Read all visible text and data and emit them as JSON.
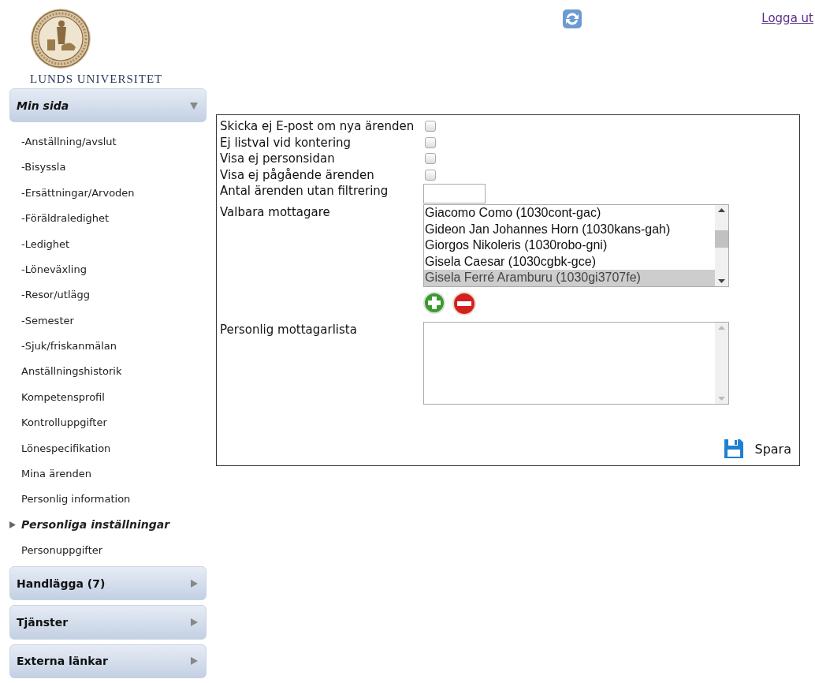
{
  "header": {
    "university": "LUNDS UNIVERSITET",
    "logout": "Logga ut"
  },
  "sidebar": [
    {
      "title": "Min sida",
      "expanded": true,
      "items": [
        {
          "label": "-Anställning/avslut",
          "selected": false
        },
        {
          "label": "-Bisyssla",
          "selected": false
        },
        {
          "label": "-Ersättningar/Arvoden",
          "selected": false
        },
        {
          "label": "-Föräldraledighet",
          "selected": false
        },
        {
          "label": "-Ledighet",
          "selected": false
        },
        {
          "label": "-Löneväxling",
          "selected": false
        },
        {
          "label": "-Resor/utlägg",
          "selected": false
        },
        {
          "label": "-Semester",
          "selected": false
        },
        {
          "label": "-Sjuk/friskanmälan",
          "selected": false
        },
        {
          "label": "Anställningshistorik",
          "selected": false
        },
        {
          "label": "Kompetensprofil",
          "selected": false
        },
        {
          "label": "Kontrolluppgifter",
          "selected": false
        },
        {
          "label": "Lönespecifikation",
          "selected": false
        },
        {
          "label": "Mina ärenden",
          "selected": false
        },
        {
          "label": "Personlig information",
          "selected": false
        },
        {
          "label": "Personliga inställningar",
          "selected": true
        },
        {
          "label": "Personuppgifter",
          "selected": false
        }
      ]
    },
    {
      "title": "Handlägga (7)",
      "expanded": false
    },
    {
      "title": "Tjänster",
      "expanded": false
    },
    {
      "title": "Externa länkar",
      "expanded": false
    }
  ],
  "form": {
    "rows": [
      {
        "kind": "checkbox",
        "label": "Skicka ej E-post om nya ärenden",
        "checked": false
      },
      {
        "kind": "checkbox",
        "label": "Ej listval vid kontering",
        "checked": false
      },
      {
        "kind": "checkbox",
        "label": "Visa ej personsidan",
        "checked": false
      },
      {
        "kind": "checkbox",
        "label": "Visa ej pågående ärenden",
        "checked": false
      },
      {
        "kind": "input",
        "label": "Antal ärenden utan filtrering"
      },
      {
        "kind": "listbox",
        "label": "Valbara mottagare",
        "options": [
          {
            "label": "Giacomo Como (1030cont-gac)",
            "selected": false
          },
          {
            "label": "Gideon Jan Johannes Horn (1030kans-gah)",
            "selected": false
          },
          {
            "label": "Giorgos Nikoleris (1030robo-gni)",
            "selected": false
          },
          {
            "label": "Gisela Caesar (1030cgbk-gce)",
            "selected": false
          },
          {
            "label": "Gisela Ferré Aramburu (1030gi3707fe)",
            "selected": true
          }
        ]
      },
      {
        "kind": "listbox",
        "label": "Personlig mottagarlista",
        "options": []
      }
    ],
    "save": "Spara"
  }
}
